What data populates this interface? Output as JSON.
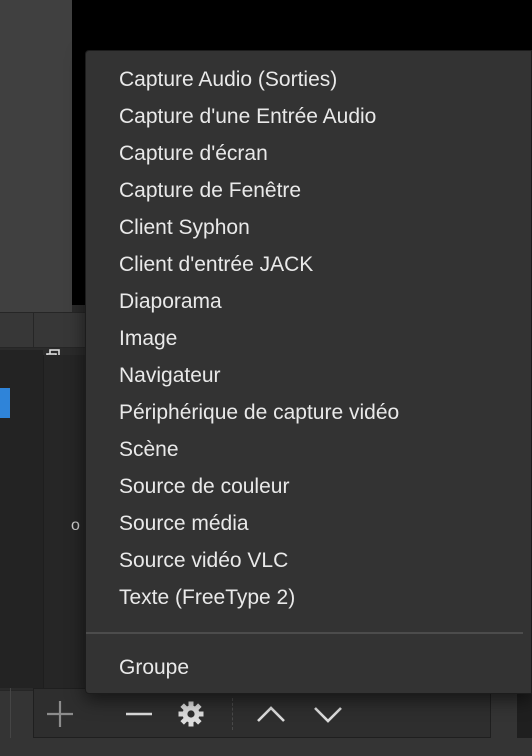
{
  "context_menu": {
    "items": [
      {
        "label": "Capture Audio (Sorties)"
      },
      {
        "label": "Capture d'une Entrée Audio"
      },
      {
        "label": "Capture d'écran"
      },
      {
        "label": "Capture de Fenêtre"
      },
      {
        "label": "Client Syphon"
      },
      {
        "label": "Client d'entrée JACK"
      },
      {
        "label": "Diaporama"
      },
      {
        "label": "Image"
      },
      {
        "label": "Navigateur"
      },
      {
        "label": "Périphérique de capture vidéo"
      },
      {
        "label": "Scène"
      },
      {
        "label": "Source de couleur"
      },
      {
        "label": "Source média"
      },
      {
        "label": "Source vidéo VLC"
      },
      {
        "label": "Texte (FreeType 2)"
      }
    ],
    "group_label": "Groupe"
  },
  "background": {
    "partial_text": "o"
  },
  "toolbar": {
    "icons": [
      "add-icon",
      "remove-icon",
      "gear-icon",
      "move-up-icon",
      "move-down-icon"
    ]
  },
  "colors": {
    "menu_bg": "#333333",
    "selection_accent": "#2f84d9",
    "preview_bg": "#000000"
  }
}
